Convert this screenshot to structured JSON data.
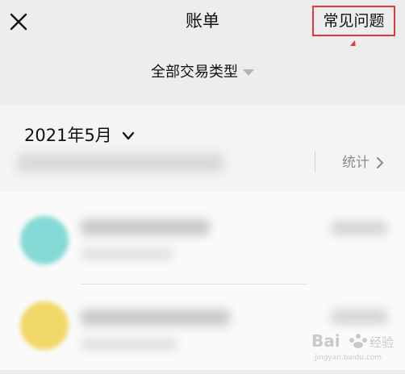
{
  "header": {
    "title": "账单",
    "faq_label": "常见问题"
  },
  "filter": {
    "label": "全部交易类型"
  },
  "month": {
    "label": "2021年5月"
  },
  "stats": {
    "label": "统计"
  },
  "transactions": [
    {
      "avatar_color": "#84d9d4"
    },
    {
      "avatar_color": "#f1d767"
    }
  ],
  "watermark": {
    "brand_text": "Bai",
    "brand_suffix": "经验",
    "url": "jingyan.baidu.com"
  },
  "colors": {
    "annotation_red": "#e03a3a"
  }
}
